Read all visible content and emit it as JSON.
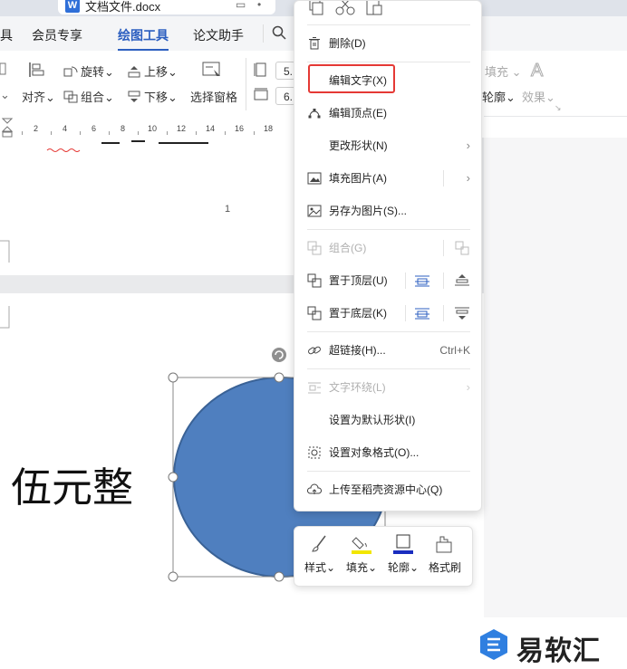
{
  "title_bar": {
    "doc_name": "文档文件.docx",
    "app_badge": "W"
  },
  "menu_tabs": [
    "具",
    "会员专享",
    "绘图工具",
    "论文助手"
  ],
  "active_tab": "绘图工具",
  "toolbar": {
    "row1": {
      "rotate": "旋转",
      "bring_forward": "上移"
    },
    "row2": {
      "align": "对齐",
      "group": "组合",
      "send_backward": "下移",
      "selection_pane": "选择窗格"
    },
    "width_value": "5.",
    "height_value": "6.",
    "fill": "填充",
    "outline": "轮廓",
    "effects": "效果"
  },
  "ruler_labels": [
    "2",
    "4",
    "6",
    "8",
    "10",
    "12",
    "14",
    "16",
    "18"
  ],
  "page": {
    "page_number": "1",
    "body_text": "伍元整"
  },
  "context_menu": {
    "top_icons": [
      "copy-icon",
      "cut-icon",
      "paste-icon"
    ],
    "items": {
      "delete": "删除(D)",
      "edit_text": "编辑文字(X)",
      "edit_points": "编辑顶点(E)",
      "change_shape": "更改形状(N)",
      "fill_picture": "填充图片(A)",
      "save_as_picture": "另存为图片(S)...",
      "group": "组合(G)",
      "bring_to_front": "置于顶层(U)",
      "send_to_back": "置于底层(K)",
      "hyperlink": "超链接(H)...",
      "hyperlink_shortcut": "Ctrl+K",
      "text_wrap": "文字环绕(L)",
      "set_default": "设置为默认形状(I)",
      "format_object": "设置对象格式(O)...",
      "upload": "上传至稻壳资源中心(Q)"
    }
  },
  "mini_toolbar": {
    "style": "样式",
    "fill": "填充",
    "outline": "轮廓",
    "format_painter": "格式刷"
  },
  "colors": {
    "accent": "#2c5fc0",
    "shape_fill": "#4f7fbf",
    "shape_stroke": "#3a6296",
    "highlight_border": "#e53935",
    "fill_swatch": "#f2e600",
    "outline_swatch": "#1a2dbf"
  },
  "watermark": "易软汇"
}
